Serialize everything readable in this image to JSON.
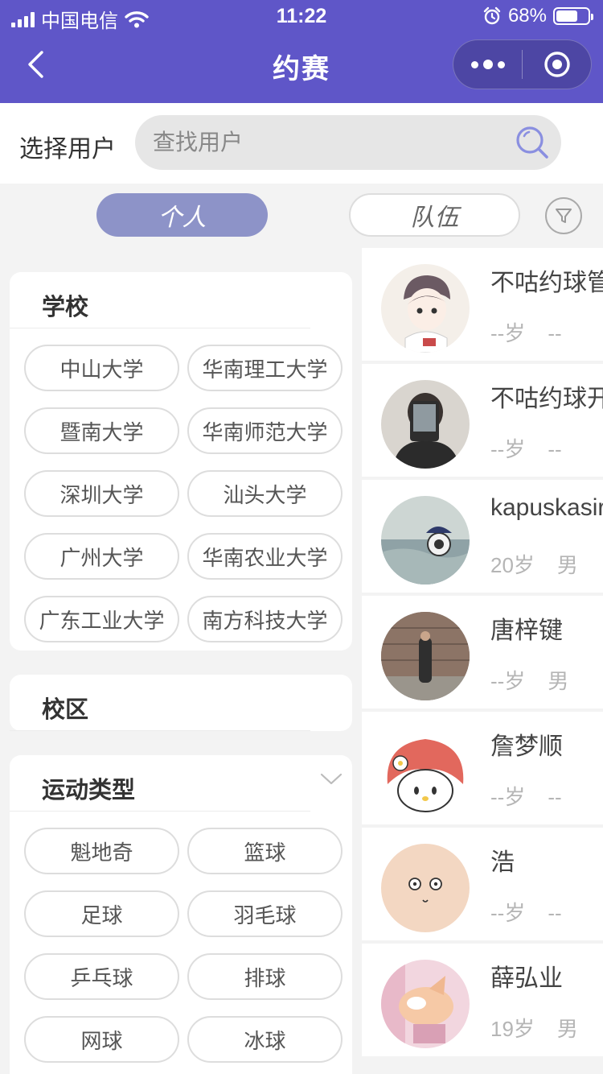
{
  "status_bar": {
    "carrier": "中国电信",
    "time": "11:22",
    "battery": "68%",
    "battery_level": 0.68
  },
  "nav": {
    "title": "约赛"
  },
  "search": {
    "label": "选择用户",
    "placeholder": "查找用户"
  },
  "tabs": {
    "individual": "个人",
    "team": "队伍"
  },
  "filters": {
    "school": {
      "title": "学校",
      "options": [
        "中山大学",
        "华南理工大学",
        "暨南大学",
        "华南师范大学",
        "深圳大学",
        "汕头大学",
        "广州大学",
        "华南农业大学",
        "广东工业大学",
        "南方科技大学"
      ]
    },
    "campus": {
      "title": "校区"
    },
    "sport": {
      "title": "运动类型",
      "options": [
        "魁地奇",
        "篮球",
        "足球",
        "羽毛球",
        "乒乓球",
        "排球",
        "网球",
        "冰球"
      ]
    }
  },
  "users": [
    {
      "name": "不咕约球管",
      "age": "--岁",
      "gender": "--"
    },
    {
      "name": "不咕约球开",
      "age": "--岁",
      "gender": "--"
    },
    {
      "name": "kapuskasir",
      "age": "20岁",
      "gender": "男"
    },
    {
      "name": "唐梓键",
      "age": "--岁",
      "gender": "男"
    },
    {
      "name": "詹梦顺",
      "age": "--岁",
      "gender": "--"
    },
    {
      "name": "浩",
      "age": "--岁",
      "gender": "--"
    },
    {
      "name": "薛弘业",
      "age": "19岁",
      "gender": "男"
    }
  ],
  "colors": {
    "nav_bg": "#5f56c8",
    "tab_active": "#8d93c8",
    "search_icon": "#8a8fe0"
  }
}
